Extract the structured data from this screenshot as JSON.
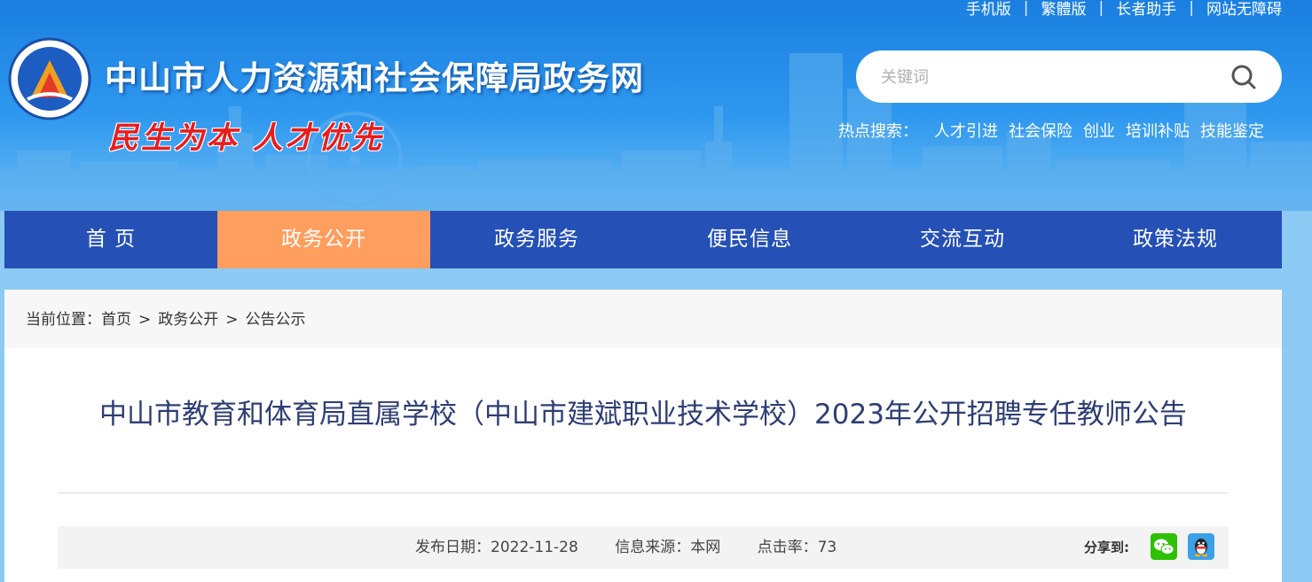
{
  "header": {
    "top_links": [
      "手机版",
      "繁體版",
      "长者助手",
      "网站无障碍"
    ],
    "site_title": "中山市人力资源和社会保障局政务网",
    "slogan": "民生为本 人才优先",
    "search": {
      "placeholder": "关键词"
    },
    "hot_label": "热点搜索：",
    "hot_terms": [
      "人才引进",
      "社会保险",
      "创业",
      "培训补贴",
      "技能鉴定"
    ]
  },
  "nav": {
    "items": [
      "首 页",
      "政务公开",
      "政务服务",
      "便民信息",
      "交流互动",
      "政策法规"
    ],
    "active_index": 1
  },
  "breadcrumb": {
    "prefix": "当前位置：",
    "items": [
      "首页",
      "政务公开",
      "公告公示"
    ],
    "separator": ">"
  },
  "article": {
    "title": "中山市教育和体育局直属学校（中山市建斌职业技术学校）2023年公开招聘专任教师公告",
    "publish_date": "发布日期：2022-11-28",
    "source": "信息来源：本网",
    "clicks": "点击率：73",
    "share_label": "分享到:"
  },
  "colors": {
    "nav_bg": "#2550b5",
    "nav_active": "#ff9e5e",
    "title_color": "#2e3e74",
    "slogan_red": "#e81d1d"
  }
}
